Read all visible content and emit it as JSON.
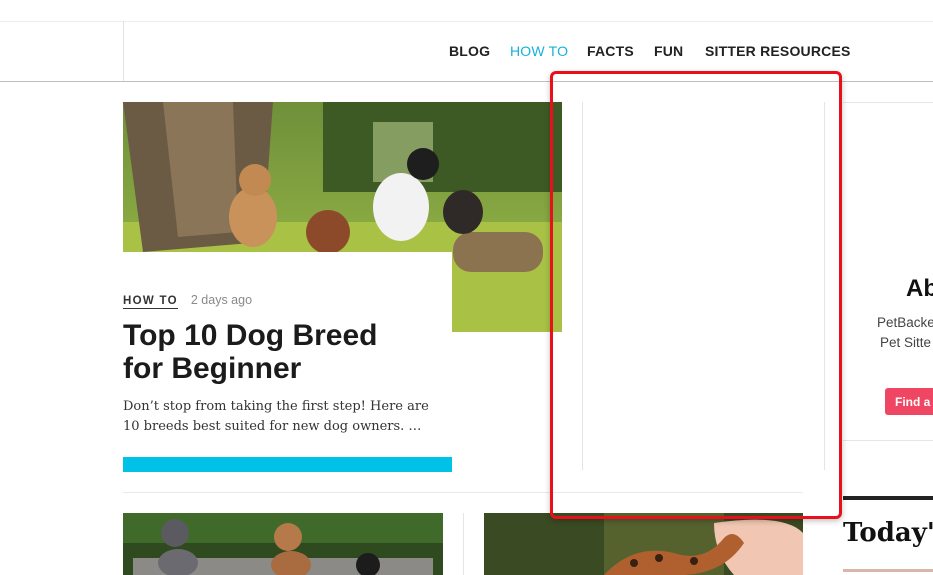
{
  "nav": {
    "items": [
      {
        "label": "BLOG",
        "active": false
      },
      {
        "label": "HOW TO",
        "active": true
      },
      {
        "label": "FACTS",
        "active": false
      },
      {
        "label": "FUN",
        "active": false
      },
      {
        "label": "SITTER RESOURCES",
        "active": false
      }
    ]
  },
  "featured": {
    "category": "HOW TO",
    "date": "2 days ago",
    "title_line1": "Top 10 Dog Breed",
    "title_line2": "for Beginner",
    "excerpt_line1": "Don’t stop from taking the first step! Here are",
    "excerpt_line2": "10 breeds best suited for new dog owners.  …"
  },
  "sidebar": {
    "about_heading": "Ab",
    "about_line1": "PetBacke",
    "about_line2": "Pet Sitte",
    "find_button": "Find a",
    "today_heading": "Today'"
  },
  "colors": {
    "accent": "#14b2d6",
    "cta_bar": "#00c1e6",
    "find_button": "#ef4763",
    "highlight": "#e8101a"
  }
}
